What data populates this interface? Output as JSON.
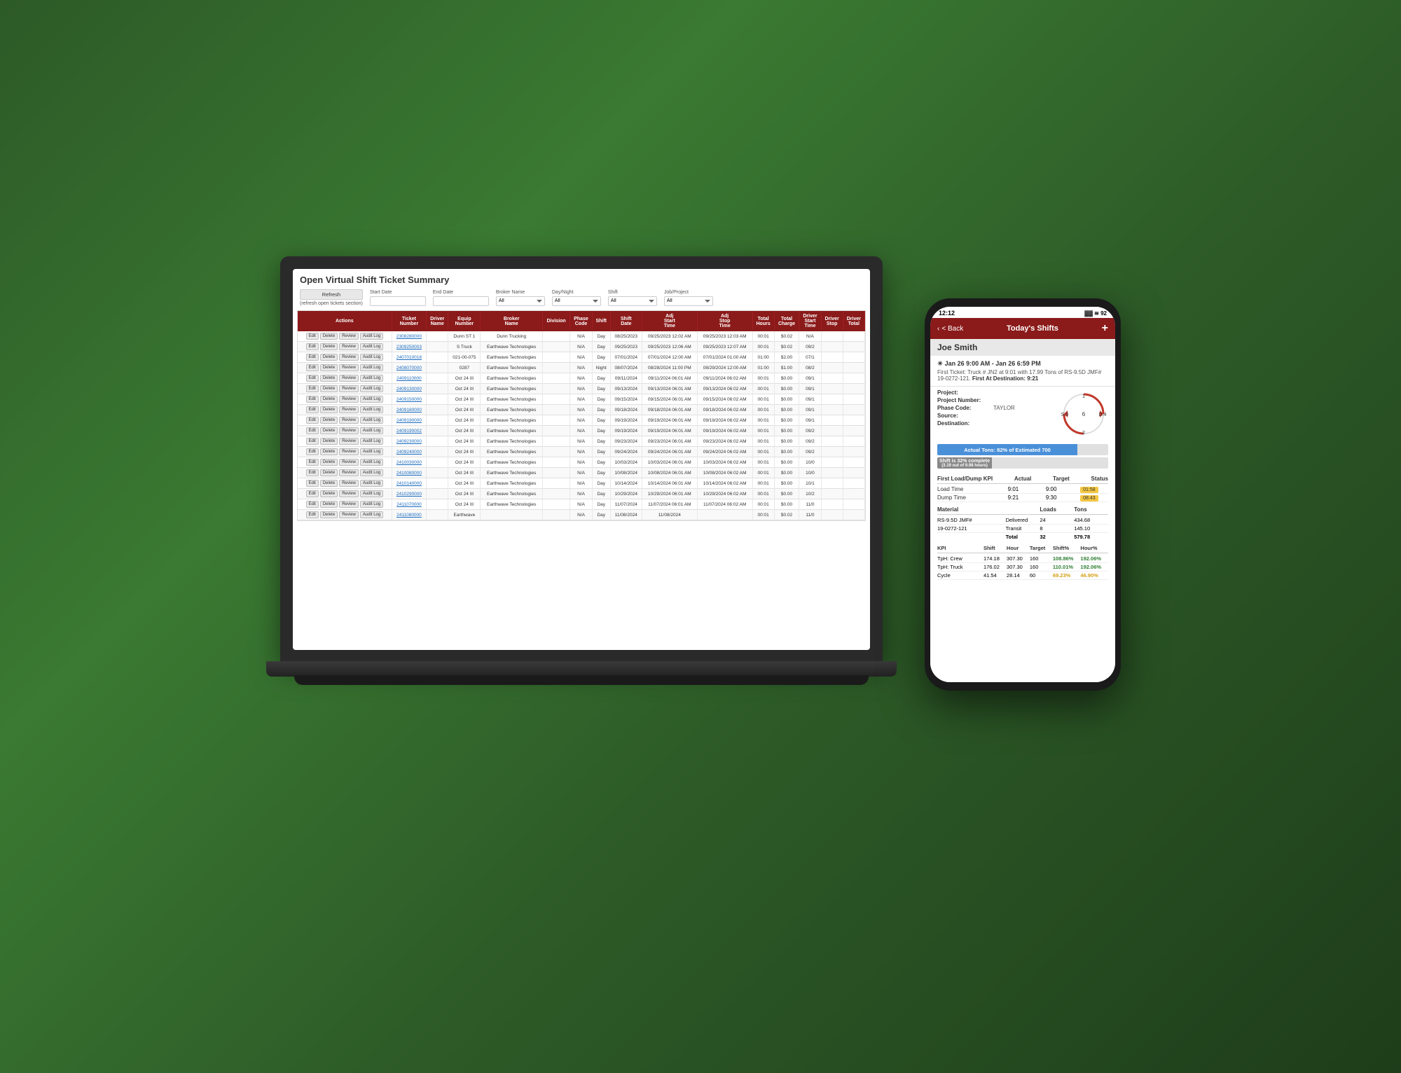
{
  "page": {
    "title": "Open Virtual Shift Ticket Summary",
    "refresh_label": "Refresh",
    "refresh_note": "(refresh open tickets section)"
  },
  "filters": {
    "start_date_label": "Start Date",
    "end_date_label": "End Date",
    "broker_name_label": "Broker Name",
    "broker_name_default": "All",
    "day_night_label": "Day/Night",
    "day_night_default": "All",
    "shift_label": "Shift",
    "shift_default": "All",
    "job_project_label": "Job/Project",
    "job_project_default": "All"
  },
  "table": {
    "columns": [
      "Actions",
      "Ticket Number",
      "Driver Name",
      "Equip Number",
      "Broker Name",
      "Division",
      "Phase Code",
      "Shift",
      "Shift Date",
      "Adj Start Time",
      "Adj Stop Time",
      "Total Hours",
      "Total Charge",
      "Driver Start Time",
      "Driver Stop",
      "Driver Total"
    ],
    "rows": [
      {
        "actions": [
          "Edit",
          "Delete",
          "Review",
          "Audit Log"
        ],
        "ticket": "2308280000",
        "driver": "",
        "equip": "Dunn ST 1",
        "broker": "Dunn Trucking",
        "division": "",
        "phase": "N/A",
        "shift": "Day",
        "shift_date": "08/25/2023",
        "adj_start": "09/25/2023 12:02 AM",
        "adj_stop": "09/25/2023 12:03 AM",
        "total_hours": "00:01",
        "total_charge": "$0.02",
        "drv_start": "N/A",
        "drv_stop": "",
        "drv_total": ""
      },
      {
        "actions": [
          "Edit",
          "Delete",
          "Review",
          "Audit Log"
        ],
        "ticket": "2309250003",
        "driver": "",
        "equip": "S Truck",
        "broker": "Earthwave Technologies",
        "division": "",
        "phase": "N/A",
        "shift": "Day",
        "shift_date": "09/25/2023",
        "adj_start": "09/25/2023 12:06 AM",
        "adj_stop": "09/25/2023 12:07 AM",
        "total_hours": "00:01",
        "total_charge": "$0.02",
        "drv_start": "09/2",
        "drv_stop": "",
        "drv_total": ""
      },
      {
        "actions": [
          "Edit",
          "Delete",
          "Review",
          "Audit Log"
        ],
        "ticket": "2407010018",
        "driver": "",
        "equip": "021-00-075",
        "broker": "Earthwave Technologies",
        "division": "",
        "phase": "N/A",
        "shift": "Day",
        "shift_date": "07/01/2024",
        "adj_start": "07/01/2024 12:00 AM",
        "adj_stop": "07/01/2024 01:00 AM",
        "total_hours": "01:00",
        "total_charge": "$2.00",
        "drv_start": "07/1",
        "drv_stop": "",
        "drv_total": ""
      },
      {
        "actions": [
          "Edit",
          "Delete",
          "Review",
          "Audit Log"
        ],
        "ticket": "2408070000",
        "driver": "",
        "equip": "0287",
        "broker": "Earthwave Technologies",
        "division": "",
        "phase": "N/A",
        "shift": "Night",
        "shift_date": "08/07/2024",
        "adj_start": "08/28/2024 11:00 PM",
        "adj_stop": "08/29/2024 12:00 AM",
        "total_hours": "01:00",
        "total_charge": "$1.00",
        "drv_start": "08/2",
        "drv_stop": "",
        "drv_total": ""
      },
      {
        "actions": [
          "Edit",
          "Delete",
          "Review",
          "Audit Log"
        ],
        "ticket": "2409110000",
        "driver": "",
        "equip": "Oct 24 III",
        "broker": "Earthwave Technologies",
        "division": "",
        "phase": "N/A",
        "shift": "Day",
        "shift_date": "09/11/2024",
        "adj_start": "09/11/2024 06:01 AM",
        "adj_stop": "09/11/2024 06:02 AM",
        "total_hours": "00:01",
        "total_charge": "$0.00",
        "drv_start": "09/1",
        "drv_stop": "",
        "drv_total": ""
      },
      {
        "actions": [
          "Edit",
          "Delete",
          "Review",
          "Audit Log"
        ],
        "ticket": "2409130000",
        "driver": "",
        "equip": "Oct 24 III",
        "broker": "Earthwave Technologies",
        "division": "",
        "phase": "N/A",
        "shift": "Day",
        "shift_date": "09/13/2024",
        "adj_start": "09/13/2024 06:01 AM",
        "adj_stop": "09/13/2024 06:02 AM",
        "total_hours": "00:01",
        "total_charge": "$0.00",
        "drv_start": "09/1",
        "drv_stop": "",
        "drv_total": ""
      },
      {
        "actions": [
          "Edit",
          "Delete",
          "Review",
          "Audit Log"
        ],
        "ticket": "2409150000",
        "driver": "",
        "equip": "Oct 24 III",
        "broker": "Earthwave Technologies",
        "division": "",
        "phase": "N/A",
        "shift": "Day",
        "shift_date": "09/15/2024",
        "adj_start": "09/15/2024 06:01 AM",
        "adj_stop": "09/15/2024 06:02 AM",
        "total_hours": "00:01",
        "total_charge": "$0.00",
        "drv_start": "09/1",
        "drv_stop": "",
        "drv_total": ""
      },
      {
        "actions": [
          "Edit",
          "Delete",
          "Review",
          "Audit Log"
        ],
        "ticket": "2409180000",
        "driver": "",
        "equip": "Oct 24 III",
        "broker": "Earthwave Technologies",
        "division": "",
        "phase": "N/A",
        "shift": "Day",
        "shift_date": "09/18/2024",
        "adj_start": "09/18/2024 06:01 AM",
        "adj_stop": "09/18/2024 06:02 AM",
        "total_hours": "00:01",
        "total_charge": "$0.00",
        "drv_start": "09/1",
        "drv_stop": "",
        "drv_total": ""
      },
      {
        "actions": [
          "Edit",
          "Delete",
          "Review",
          "Audit Log"
        ],
        "ticket": "2409190000",
        "driver": "",
        "equip": "Oct 24 III",
        "broker": "Earthwave Technologies",
        "division": "",
        "phase": "N/A",
        "shift": "Day",
        "shift_date": "09/19/2024",
        "adj_start": "09/19/2024 06:01 AM",
        "adj_stop": "09/19/2024 06:02 AM",
        "total_hours": "00:01",
        "total_charge": "$0.00",
        "drv_start": "09/1",
        "drv_stop": "",
        "drv_total": ""
      },
      {
        "actions": [
          "Edit",
          "Delete",
          "Review",
          "Audit Log"
        ],
        "ticket": "2409190002",
        "driver": "",
        "equip": "Oct 24 III",
        "broker": "Earthwave Technologies",
        "division": "",
        "phase": "N/A",
        "shift": "Day",
        "shift_date": "09/19/2024",
        "adj_start": "09/19/2024 06:01 AM",
        "adj_stop": "09/19/2024 06:02 AM",
        "total_hours": "00:01",
        "total_charge": "$0.00",
        "drv_start": "09/2",
        "drv_stop": "",
        "drv_total": ""
      },
      {
        "actions": [
          "Edit",
          "Delete",
          "Review",
          "Audit Log"
        ],
        "ticket": "2409230000",
        "driver": "",
        "equip": "Oct 24 III",
        "broker": "Earthwave Technologies",
        "division": "",
        "phase": "N/A",
        "shift": "Day",
        "shift_date": "09/23/2024",
        "adj_start": "09/23/2024 06:01 AM",
        "adj_stop": "09/23/2024 06:02 AM",
        "total_hours": "00:01",
        "total_charge": "$0.00",
        "drv_start": "09/2",
        "drv_stop": "",
        "drv_total": ""
      },
      {
        "actions": [
          "Edit",
          "Delete",
          "Review",
          "Audit Log"
        ],
        "ticket": "2409240000",
        "driver": "",
        "equip": "Oct 24 III",
        "broker": "Earthwave Technologies",
        "division": "",
        "phase": "N/A",
        "shift": "Day",
        "shift_date": "09/24/2024",
        "adj_start": "09/24/2024 06:01 AM",
        "adj_stop": "09/24/2024 06:02 AM",
        "total_hours": "00:01",
        "total_charge": "$0.00",
        "drv_start": "09/2",
        "drv_stop": "",
        "drv_total": ""
      },
      {
        "actions": [
          "Edit",
          "Delete",
          "Review",
          "Audit Log"
        ],
        "ticket": "2410030000",
        "driver": "",
        "equip": "Oct 24 III",
        "broker": "Earthwave Technologies",
        "division": "",
        "phase": "N/A",
        "shift": "Day",
        "shift_date": "10/03/2024",
        "adj_start": "10/03/2024 06:01 AM",
        "adj_stop": "10/03/2024 06:02 AM",
        "total_hours": "00:01",
        "total_charge": "$0.00",
        "drv_start": "10/0",
        "drv_stop": "",
        "drv_total": ""
      },
      {
        "actions": [
          "Edit",
          "Delete",
          "Review",
          "Audit Log"
        ],
        "ticket": "2410080000",
        "driver": "",
        "equip": "Oct 24 III",
        "broker": "Earthwave Technologies",
        "division": "",
        "phase": "N/A",
        "shift": "Day",
        "shift_date": "10/08/2024",
        "adj_start": "10/08/2024 06:01 AM",
        "adj_stop": "10/08/2024 06:02 AM",
        "total_hours": "00:01",
        "total_charge": "$0.00",
        "drv_start": "10/0",
        "drv_stop": "",
        "drv_total": ""
      },
      {
        "actions": [
          "Edit",
          "Delete",
          "Review",
          "Audit Log"
        ],
        "ticket": "2410140000",
        "driver": "",
        "equip": "Oct 24 III",
        "broker": "Earthwave Technologies",
        "division": "",
        "phase": "N/A",
        "shift": "Day",
        "shift_date": "10/14/2024",
        "adj_start": "10/14/2024 06:01 AM",
        "adj_stop": "10/14/2024 06:02 AM",
        "total_hours": "00:01",
        "total_charge": "$0.00",
        "drv_start": "10/1",
        "drv_stop": "",
        "drv_total": ""
      },
      {
        "actions": [
          "Edit",
          "Delete",
          "Review",
          "Audit Log"
        ],
        "ticket": "2410290000",
        "driver": "",
        "equip": "Oct 24 III",
        "broker": "Earthwave Technologies",
        "division": "",
        "phase": "N/A",
        "shift": "Day",
        "shift_date": "10/29/2024",
        "adj_start": "10/29/2024 06:01 AM",
        "adj_stop": "10/29/2024 06:02 AM",
        "total_hours": "00:01",
        "total_charge": "$0.00",
        "drv_start": "10/2",
        "drv_stop": "",
        "drv_total": ""
      },
      {
        "actions": [
          "Edit",
          "Delete",
          "Review",
          "Audit Log"
        ],
        "ticket": "2411070000",
        "driver": "",
        "equip": "Oct 24 III",
        "broker": "Earthwave Technologies",
        "division": "",
        "phase": "N/A",
        "shift": "Day",
        "shift_date": "11/07/2024",
        "adj_start": "11/07/2024 06:01 AM",
        "adj_stop": "11/07/2024 06:02 AM",
        "total_hours": "00:01",
        "total_charge": "$0.00",
        "drv_start": "11/0",
        "drv_stop": "",
        "drv_total": ""
      },
      {
        "actions": [
          "Edit",
          "Delete",
          "Review",
          "Audit Log"
        ],
        "ticket": "2411080000",
        "driver": "",
        "equip": "Earthwave",
        "broker": "",
        "division": "",
        "phase": "N/A",
        "shift": "Day",
        "shift_date": "11/08/2024",
        "adj_start": "11/08/2024",
        "adj_stop": "",
        "total_hours": "00:01",
        "total_charge": "$0.02",
        "drv_start": "11/0",
        "drv_stop": "",
        "drv_total": ""
      }
    ]
  },
  "phone": {
    "time": "12:12",
    "status_icons": "▓ ≋ ⬛ 92",
    "nav_back": "< Back",
    "nav_title": "Today's Shifts",
    "nav_plus": "+",
    "driver_name": "Joe Smith",
    "shift_range": "☀ Jan 26 9:00 AM - Jan 26 6:59 PM",
    "first_ticket": "First Ticket: Truck # JN2 at 9:01 with 17.99 Tons of RS-9.5D JMF# 19-0272-121.",
    "first_destination": "First At Destination: 9:21",
    "project_label": "Project:",
    "project_value": "",
    "project_number_label": "Project Number:",
    "project_number_value": "",
    "phase_code_label": "Phase Code:",
    "phase_code_value": "TAYLOR",
    "source_label": "Source:",
    "source_value": "",
    "destination_label": "Destination:",
    "destination_value": "",
    "circle_s": "S:3",
    "circle_6": "6",
    "circle_d": "D:4",
    "circle_1": "1",
    "circle_2": "2",
    "progress_actual_label": "Actual Tons: 82% of Estimated 700",
    "progress_actual_pct": 82,
    "progress_shift_label": "Shift is 32% complete",
    "progress_shift_sub": "(3.19 out of 9.98 hours)",
    "progress_shift_pct": 32,
    "kpi_title": "First Load/Dump KPI",
    "kpi_col_actual": "Actual",
    "kpi_col_target": "Target",
    "kpi_col_status": "Status",
    "load_time_label": "Load Time",
    "load_time_actual": "9:01",
    "load_time_target": "9:00",
    "load_time_status": "01:58",
    "dump_time_label": "Dump Time",
    "dump_time_actual": "9:21",
    "dump_time_target": "9:30",
    "dump_time_status": "08:43",
    "material_col1": "Material",
    "material_col2": "Loads",
    "material_col3": "Tons",
    "mat_name": "RS-9.5D JMF#",
    "mat_name2": "19-0272-121",
    "mat_delivered_label": "Delivered",
    "mat_delivered_loads": "24",
    "mat_delivered_tons": "434.68",
    "mat_transit_label": "Transit",
    "mat_transit_loads": "8",
    "mat_transit_tons": "145.10",
    "mat_total_label": "Total",
    "mat_total_loads": "32",
    "mat_total_tons": "579.78",
    "kpi2_col_kpi": "KPI",
    "kpi2_col_shift": "Shift",
    "kpi2_col_hour": "Hour",
    "kpi2_col_target": "Target",
    "kpi2_col_shiftp": "Shift%",
    "kpi2_col_hourp": "Hour%",
    "kpi2_row1_label": "TpH: Crew",
    "kpi2_row1_shift": "174.18",
    "kpi2_row1_hour": "307.30",
    "kpi2_row1_target": "160",
    "kpi2_row1_shiftp": "108.86%",
    "kpi2_row1_hourp": "192.06%",
    "kpi2_row2_label": "TpH: Truck",
    "kpi2_row2_shift": "176.02",
    "kpi2_row2_hour": "307.30",
    "kpi2_row2_target": "160",
    "kpi2_row2_shiftp": "110.01%",
    "kpi2_row2_hourp": "192.06%",
    "kpi2_row3_label": "Cycle",
    "kpi2_row3_shift": "41.54",
    "kpi2_row3_hour": "28.14",
    "kpi2_row3_target": "60",
    "kpi2_row3_shiftp": "69.23%",
    "kpi2_row3_hourp": "46.90%"
  }
}
